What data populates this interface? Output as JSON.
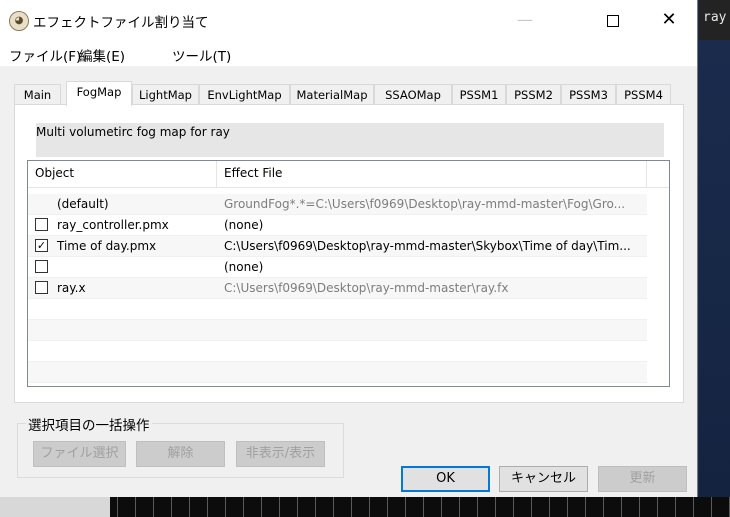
{
  "window": {
    "title": "エフェクトファイル割り当て",
    "minimize": "—",
    "close": "✕"
  },
  "background_app": {
    "label": "ray"
  },
  "menubar": {
    "items": [
      "ファイル(F)",
      "編集(E)",
      "ツール(T)"
    ]
  },
  "tabs": {
    "items": [
      "Main",
      "FogMap",
      "LightMap",
      "EnvLightMap",
      "MaterialMap",
      "SSAOMap",
      "PSSM1",
      "PSSM2",
      "PSSM3",
      "PSSM4"
    ],
    "selected": "FogMap"
  },
  "description": "Multi volumetirc fog map for ray",
  "list": {
    "columns": [
      "Object",
      "Effect File"
    ],
    "rows": [
      {
        "object": "(default)",
        "effect": "GroundFog*.*=C:\\Users\\f0969\\Desktop\\ray-mmd-master\\Fog\\Gro...",
        "checkbox": false,
        "checked": false
      },
      {
        "object": "ray_controller.pmx",
        "effect": "(none)",
        "checkbox": true,
        "checked": false
      },
      {
        "object": "Time of day.pmx",
        "effect": "C:\\Users\\f0969\\Desktop\\ray-mmd-master\\Skybox\\Time of day\\Tim...",
        "checkbox": true,
        "checked": true
      },
      {
        "object": "",
        "effect": "(none)",
        "checkbox": true,
        "checked": false
      },
      {
        "object": "ray.x",
        "effect": "C:\\Users\\f0969\\Desktop\\ray-mmd-master\\ray.fx",
        "checkbox": true,
        "checked": false
      }
    ]
  },
  "bulk": {
    "title": "選択項目の一括操作",
    "select_file": "ファイル選択",
    "release": "解除",
    "toggle": "非表示/表示"
  },
  "buttons": {
    "ok": "OK",
    "cancel": "キャンセル",
    "update": "更新"
  },
  "checkmark": "✓",
  "colors": {
    "accent": "#0078d7",
    "disabled_text": "#a0a0a0",
    "grey_text": "#7d7d7d"
  }
}
